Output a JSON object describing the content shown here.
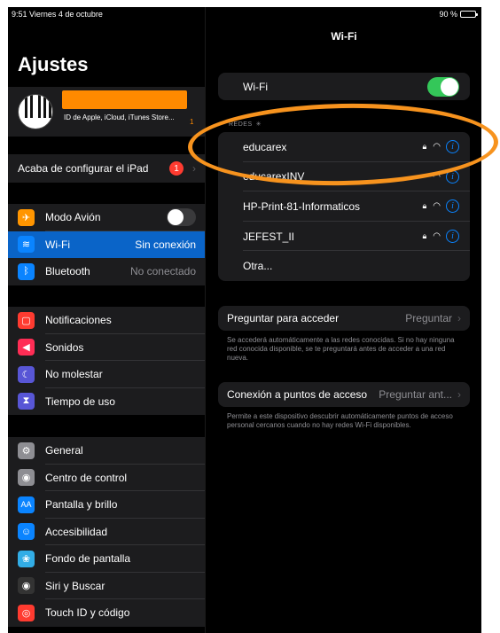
{
  "status": {
    "time_date": "9:51  Viernes 4 de octubre",
    "battery": "90 %"
  },
  "sidebar": {
    "title": "Ajustes",
    "profile_sub": "ID de Apple, iCloud, iTunes Store...",
    "profile_badge": "1",
    "finish_setup": {
      "label": "Acaba de configurar el iPad",
      "badge": "1"
    },
    "connectivity": [
      {
        "label": "Modo Avión",
        "icon": "airplane-icon",
        "color": "#ff9500",
        "glyph": "✈",
        "value": ""
      },
      {
        "label": "Wi-Fi",
        "icon": "wifi-icon",
        "color": "#0a84ff",
        "glyph": "◠",
        "value": "Sin conexión"
      },
      {
        "label": "Bluetooth",
        "icon": "bluetooth-icon",
        "color": "#0a84ff",
        "glyph": "ᛒ",
        "value": "No conectado"
      }
    ],
    "notifications": [
      {
        "label": "Notificaciones",
        "icon": "notifications-icon",
        "color": "#ff3b30",
        "glyph": "▢"
      },
      {
        "label": "Sonidos",
        "icon": "sounds-icon",
        "color": "#ff2d55",
        "glyph": "◀"
      },
      {
        "label": "No molestar",
        "icon": "moon-icon",
        "color": "#5856d6",
        "glyph": "☾"
      },
      {
        "label": "Tiempo de uso",
        "icon": "hourglass-icon",
        "color": "#5856d6",
        "glyph": "⧗"
      }
    ],
    "general": [
      {
        "label": "General",
        "icon": "gear-icon",
        "color": "#8e8e93",
        "glyph": "⚙"
      },
      {
        "label": "Centro de control",
        "icon": "control-center-icon",
        "color": "#8e8e93",
        "glyph": "◉"
      },
      {
        "label": "Pantalla y brillo",
        "icon": "display-icon",
        "color": "#0a84ff",
        "glyph": "AA"
      },
      {
        "label": "Accesibilidad",
        "icon": "accessibility-icon",
        "color": "#0a84ff",
        "glyph": "♿"
      },
      {
        "label": "Fondo de pantalla",
        "icon": "wallpaper-icon",
        "color": "#32ade6",
        "glyph": "❀"
      },
      {
        "label": "Siri y Buscar",
        "icon": "siri-icon",
        "color": "#333333",
        "glyph": "◉"
      },
      {
        "label": "Touch ID y código",
        "icon": "fingerprint-icon",
        "color": "#ff3b30",
        "glyph": "◎"
      }
    ]
  },
  "detail": {
    "title": "Wi-Fi",
    "wifi_label": "Wi-Fi",
    "wifi_on": true,
    "networks_header": "REDES",
    "networks": [
      {
        "name": "educarex",
        "locked": true
      },
      {
        "name": "educarexINV",
        "locked": false
      },
      {
        "name": "HP-Print-81-Informaticos",
        "locked": true
      },
      {
        "name": "JEFEST_II",
        "locked": true
      }
    ],
    "other": "Otra...",
    "ask_join": {
      "label": "Preguntar para acceder",
      "value": "Preguntar"
    },
    "ask_join_note": "Se accederá automáticamente a las redes conocidas. Si no hay ninguna red conocida disponible, se te preguntará antes de acceder a una red nueva.",
    "hotspot": {
      "label": "Conexión a puntos de acceso",
      "value": "Preguntar ant..."
    },
    "hotspot_note": "Permite a este dispositivo descubrir automáticamente puntos de acceso personal cercanos cuando no hay redes Wi-Fi disponibles."
  },
  "colors": {
    "annotation": "#f7931e",
    "accent": "#0a84ff",
    "selected": "#0a64c8",
    "toggle_on": "#34c759"
  }
}
